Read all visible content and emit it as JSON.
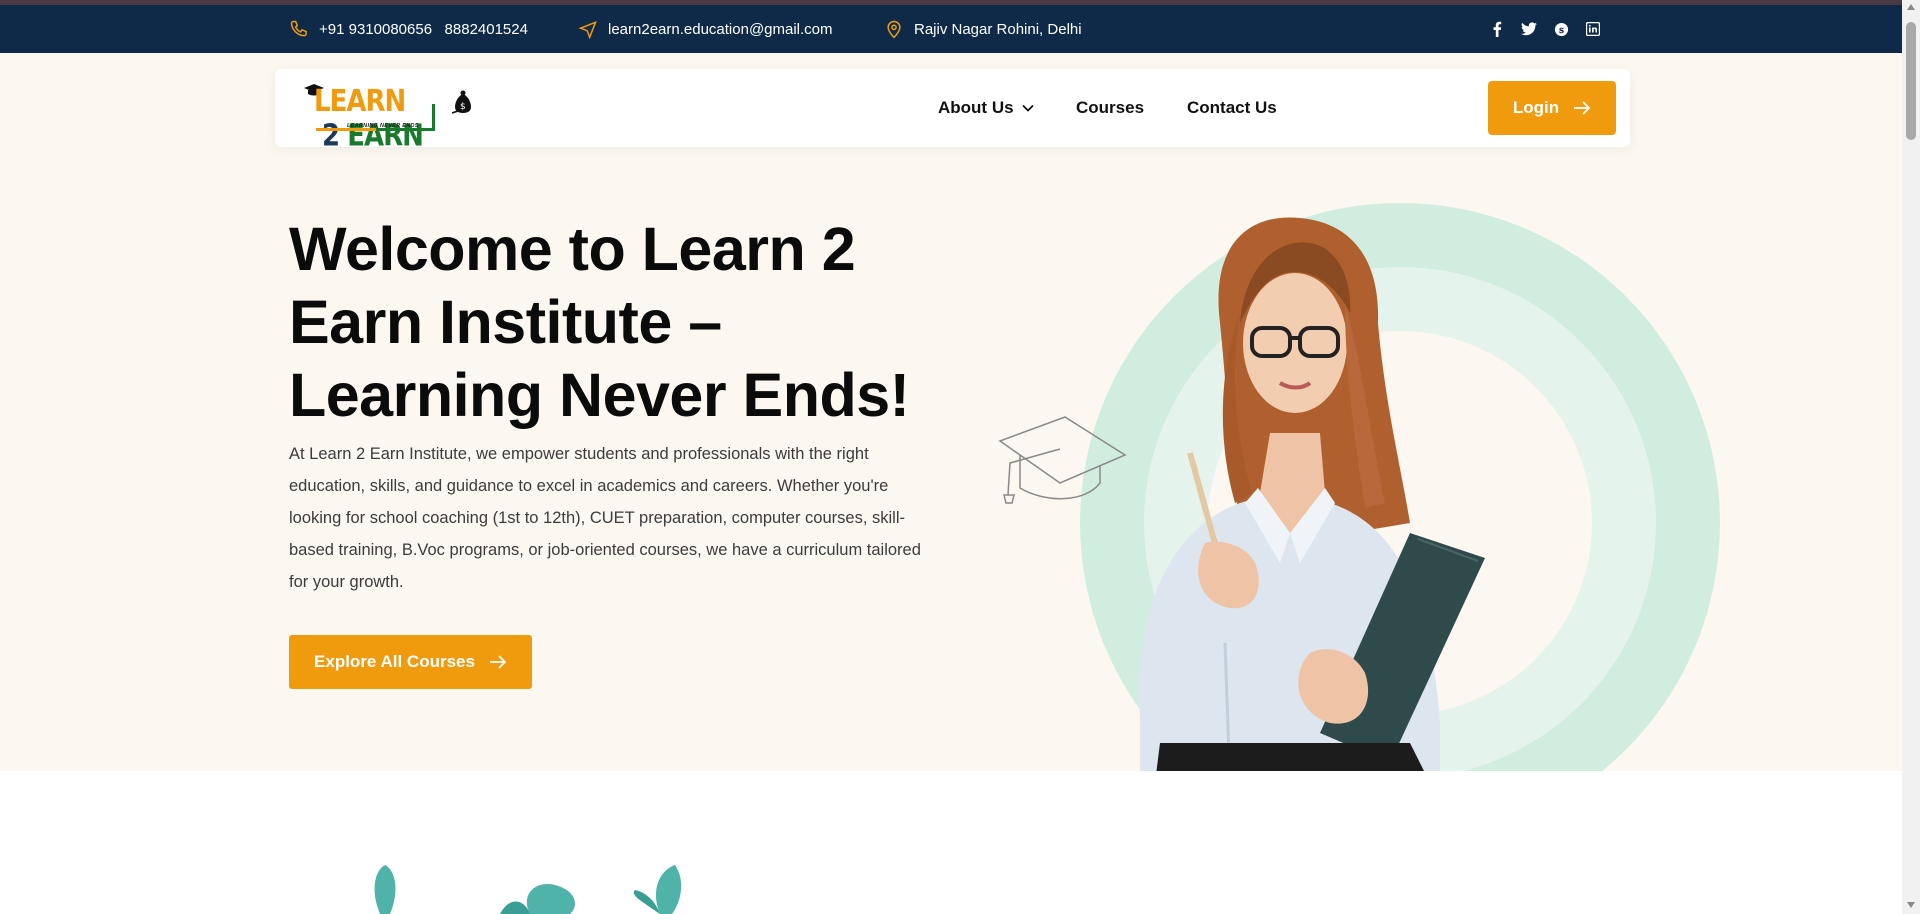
{
  "topbar": {
    "phone": "+91 9310080656   8882401524",
    "email": "learn2earn.education@gmail.com",
    "address": "Rajiv Nagar Rohini, Delhi",
    "social_icons": [
      "facebook-icon",
      "twitter-icon",
      "skype-icon",
      "linkedin-icon"
    ]
  },
  "logo": {
    "word_l": "LEARN",
    "word_two": " 2 ",
    "word_e": "EARN",
    "tagline": "LEARNING NEVER ENDS"
  },
  "nav": {
    "about": "About Us",
    "courses": "Courses",
    "contact": "Contact Us",
    "login": "Login"
  },
  "hero": {
    "title": "Welcome to Learn 2 Earn Institute – Learning Never Ends!",
    "description": "At Learn 2 Earn Institute, we empower students and professionals with the right education, skills, and guidance to excel in academics and careers. Whether you're looking for school coaching (1st to 12th), CUET preparation, computer courses, skill-based training, B.Voc programs, or job-oriented courses, we have a curriculum tailored for your growth.",
    "cta": "Explore All Courses"
  },
  "colors": {
    "topbar_bg": "#0f2a48",
    "accent": "#f09a0e",
    "hero_bg": "#fcf7f1",
    "ring": "#d1ede0"
  }
}
